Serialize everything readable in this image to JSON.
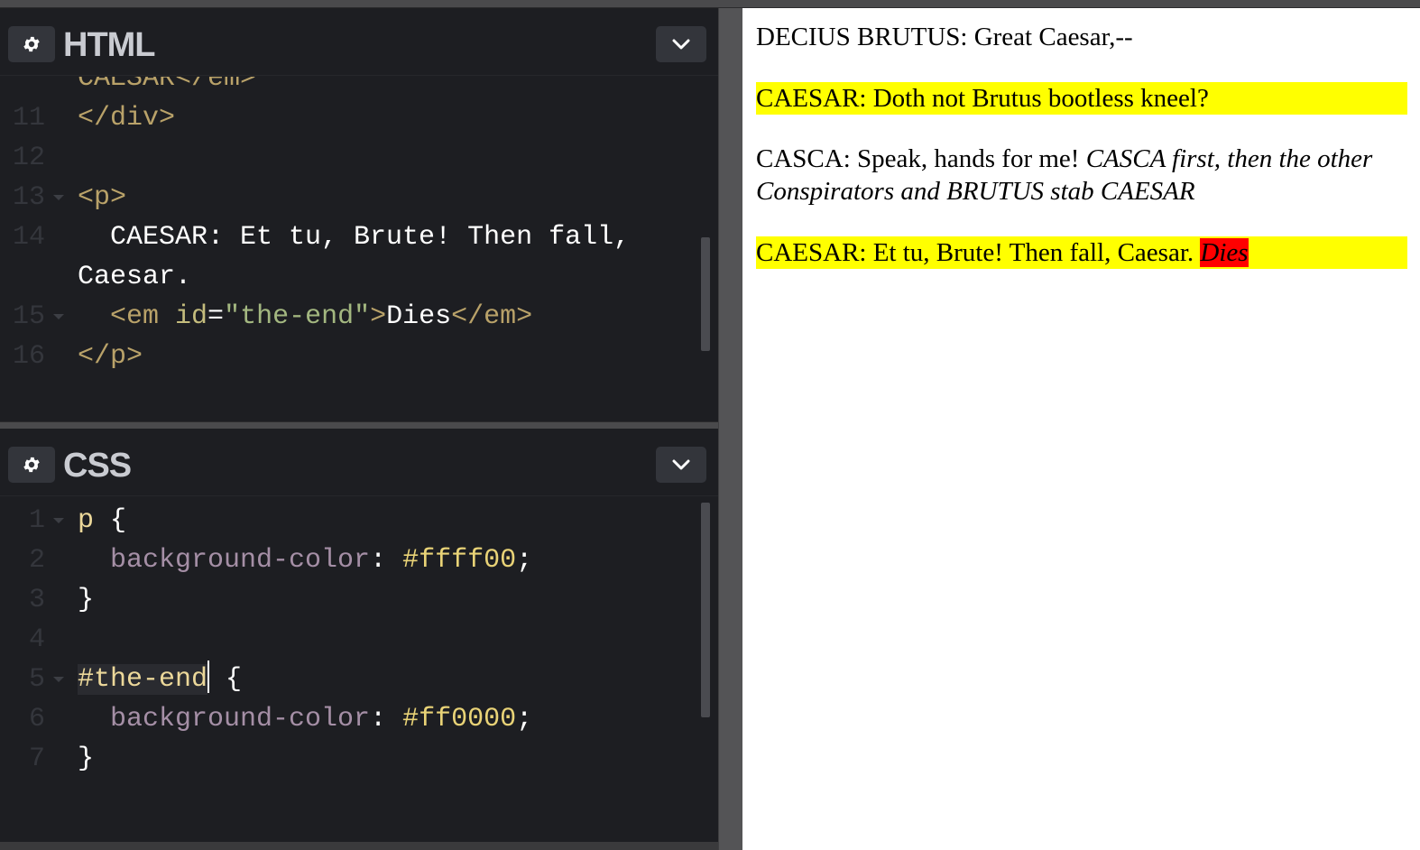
{
  "html_panel": {
    "title": "HTML",
    "lines": [
      {
        "num": "",
        "parts": [
          [
            "tok-tag",
            "CAESAR</em>"
          ]
        ],
        "clipped": true
      },
      {
        "num": "11",
        "parts": [
          [
            "tok-tag",
            "</div>"
          ]
        ]
      },
      {
        "num": "12",
        "parts": []
      },
      {
        "num": "13",
        "fold": true,
        "parts": [
          [
            "tok-tag",
            "<p>"
          ]
        ]
      },
      {
        "num": "14",
        "parts": [
          [
            "tok-pun",
            "  CAESAR: Et tu, Brute! Then fall,"
          ]
        ]
      },
      {
        "num": "",
        "parts": [
          [
            "tok-pun",
            "Caesar."
          ]
        ]
      },
      {
        "num": "15",
        "fold": true,
        "parts": [
          [
            "tok-pun",
            "  "
          ],
          [
            "tok-tag",
            "<em "
          ],
          [
            "tok-attr",
            "id"
          ],
          [
            "tok-pun",
            "="
          ],
          [
            "tok-str",
            "\"the-end\""
          ],
          [
            "tok-tag",
            ">"
          ],
          [
            "tok-pun",
            "Dies"
          ],
          [
            "tok-tag",
            "</em>"
          ]
        ]
      },
      {
        "num": "16",
        "parts": [
          [
            "tok-tag",
            "</p>"
          ]
        ]
      }
    ]
  },
  "css_panel": {
    "title": "CSS",
    "lines": [
      {
        "num": "1",
        "fold": true,
        "parts": [
          [
            "tok-sel",
            "p "
          ],
          [
            "tok-pun",
            "{"
          ]
        ]
      },
      {
        "num": "2",
        "parts": [
          [
            "tok-pun",
            "  "
          ],
          [
            "tok-prop",
            "background-color"
          ],
          [
            "tok-pun",
            ": "
          ],
          [
            "tok-val",
            "#ffff00"
          ],
          [
            "tok-pun",
            ";"
          ]
        ]
      },
      {
        "num": "3",
        "parts": [
          [
            "tok-pun",
            "}"
          ]
        ]
      },
      {
        "num": "4",
        "parts": []
      },
      {
        "num": "5",
        "fold": true,
        "cursor_after": 0,
        "parts": [
          [
            "tok-sel",
            "#the-end"
          ],
          [
            "tok-pun",
            " {"
          ]
        ]
      },
      {
        "num": "6",
        "parts": [
          [
            "tok-pun",
            "  "
          ],
          [
            "tok-prop",
            "background-color"
          ],
          [
            "tok-pun",
            ": "
          ],
          [
            "tok-val",
            "#ff0000"
          ],
          [
            "tok-pun",
            ";"
          ]
        ]
      },
      {
        "num": "7",
        "parts": [
          [
            "tok-pun",
            "}"
          ]
        ]
      }
    ]
  },
  "preview": {
    "p1": "DECIUS BRUTUS: Great Caesar,--",
    "p2": "CAESAR: Doth not Brutus bootless kneel?",
    "p3_plain": "CASCA: Speak, hands for me! ",
    "p3_em": "CASCA first, then the other Conspirators and BRUTUS stab CAESAR",
    "p4_plain": "CAESAR: Et tu, Brute! Then fall, Caesar. ",
    "p4_em": "Dies"
  },
  "colors": {
    "editor_bg": "#1d1e22",
    "highlight_yellow": "#ffff00",
    "highlight_red": "#ff0000"
  },
  "icons": {
    "settings": "gear-icon",
    "collapse": "chevron-down-icon",
    "fold": "fold-arrow-icon"
  }
}
